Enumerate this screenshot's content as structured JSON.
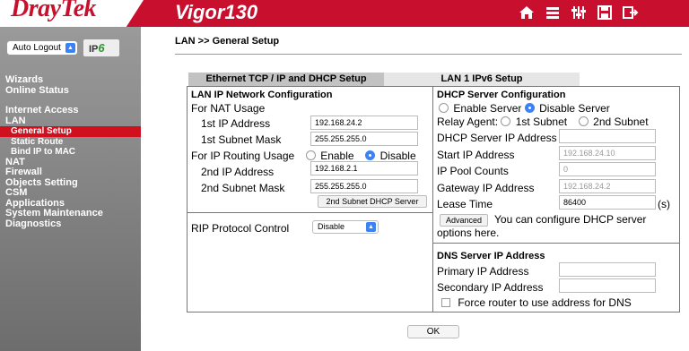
{
  "header": {
    "logo": "DrayTek",
    "model": "Vigor130",
    "icons": [
      "home-icon",
      "list-icon",
      "mixer-icon",
      "save-icon",
      "logout-icon"
    ]
  },
  "sidebar": {
    "auto_logout": "Auto Logout",
    "ipv6_label_a": "IP",
    "ipv6_label_b": "6",
    "menu": [
      "Wizards",
      "Online Status",
      "Internet Access",
      "LAN",
      "General Setup",
      "Static Route",
      "Bind IP to MAC",
      "NAT",
      "Firewall",
      "Objects Setting",
      "CSM",
      "Applications",
      "System Maintenance",
      "Diagnostics"
    ]
  },
  "breadcrumb": "LAN >> General Setup",
  "tabs": [
    "Ethernet TCP / IP and DHCP Setup",
    "LAN 1 IPv6 Setup"
  ],
  "lan": {
    "header": "LAN IP Network Configuration",
    "nat_usage": "For NAT Usage",
    "ip1_label": "1st IP Address",
    "ip1_value": "192.168.24.2",
    "mask1_label": "1st Subnet Mask",
    "mask1_value": "255.255.255.0",
    "routing_label": "For IP Routing Usage",
    "enable": "Enable",
    "disable": "Disable",
    "ip2_label": "2nd IP Address",
    "ip2_value": "192.168.2.1",
    "mask2_label": "2nd Subnet Mask",
    "mask2_value": "255.255.255.0",
    "dhcp2_button": "2nd Subnet DHCP Server",
    "rip_label": "RIP Protocol Control",
    "rip_value": "Disable"
  },
  "dhcp": {
    "header": "DHCP Server Configuration",
    "enable_server": "Enable Server",
    "disable_server": "Disable Server",
    "relay_label": "Relay Agent:",
    "first_subnet": "1st Subnet",
    "second_subnet": "2nd Subnet",
    "server_ip_label": "DHCP Server IP Address",
    "server_ip_value": "",
    "start_ip_label": "Start IP Address",
    "start_ip_value": "192.168.24.10",
    "pool_label": "IP Pool Counts",
    "pool_value": "0",
    "gateway_label": "Gateway IP Address",
    "gateway_value": "192.168.24.2",
    "lease_label": "Lease Time",
    "lease_value": "86400",
    "lease_unit": "(s)",
    "advanced_button": "Advanced",
    "advanced_text_1": "You can configure DHCP server",
    "advanced_text_2": "options here."
  },
  "dns": {
    "header": "DNS Server IP Address",
    "primary_label": "Primary IP Address",
    "primary_value": "",
    "secondary_label": "Secondary IP Address",
    "secondary_value": "",
    "force_label": "Force router to use address for DNS"
  },
  "ok": "OK"
}
